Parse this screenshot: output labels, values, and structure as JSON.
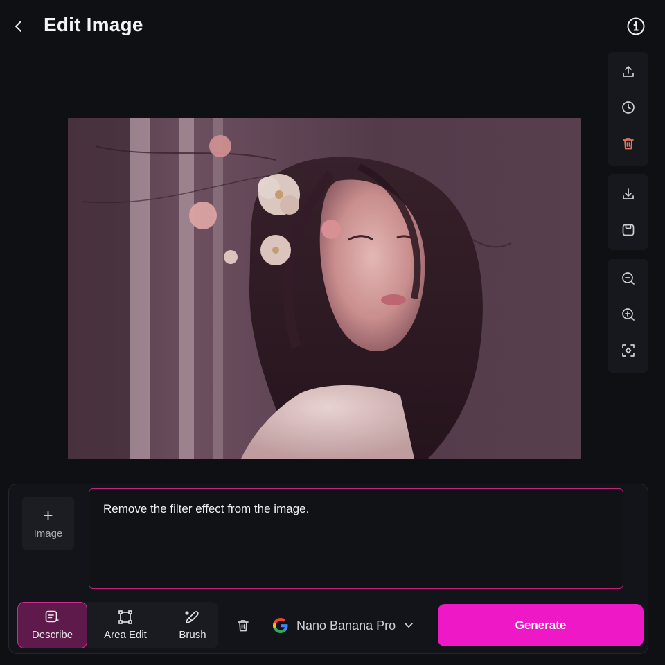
{
  "header": {
    "title": "Edit Image",
    "back_icon": "chevron-left-icon",
    "info_icon": "info-icon"
  },
  "toolbar": {
    "groups": [
      [
        "upload-icon",
        "history-icon",
        "delete-icon"
      ],
      [
        "download-icon",
        "save-icon"
      ],
      [
        "zoom-out-icon",
        "zoom-in-icon",
        "fit-screen-icon"
      ]
    ],
    "delete_color": "#e0785f"
  },
  "canvas": {
    "subject": "photo-portrait"
  },
  "composer": {
    "add_image": {
      "plus": "+",
      "label": "Image"
    },
    "prompt_text": "Remove the filter effect from the image.",
    "modes": [
      {
        "label": "Describe",
        "active": true
      },
      {
        "label": "Area Edit",
        "active": false
      },
      {
        "label": "Brush",
        "active": false
      }
    ],
    "model": {
      "name": "Nano Banana Pro"
    },
    "generate_label": "Generate"
  },
  "colors": {
    "accent": "#ee18c6",
    "active_mode_bg": "#5e1a4a",
    "prompt_border": "#c0267e",
    "background": "#0f1013"
  }
}
